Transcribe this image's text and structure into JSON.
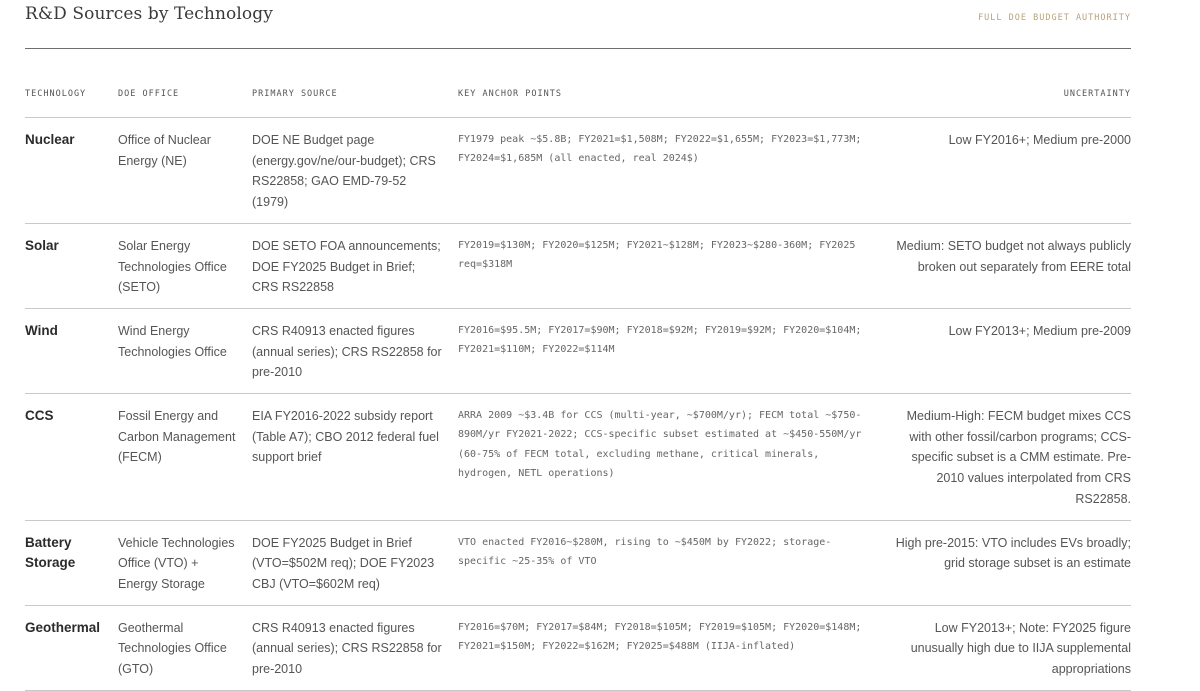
{
  "header": {
    "title": "R&D Sources by Technology",
    "subtitle": "FULL DOE BUDGET AUTHORITY"
  },
  "table": {
    "columns": [
      "TECHNOLOGY",
      "DOE OFFICE",
      "PRIMARY SOURCE",
      "KEY ANCHOR POINTS",
      "UNCERTAINTY"
    ],
    "rows": [
      {
        "technology": "Nuclear",
        "office": "Office of Nuclear Energy (NE)",
        "source": "DOE NE Budget page (energy.gov/ne/our-budget); CRS RS22858; GAO EMD-79-52 (1979)",
        "anchors": "FY1979 peak ~$5.8B; FY2021=$1,508M; FY2022=$1,655M; FY2023=$1,773M; FY2024=$1,685M (all enacted, real 2024$)",
        "uncertainty": "Low FY2016+; Medium pre-2000"
      },
      {
        "technology": "Solar",
        "office": "Solar Energy Technologies Office (SETO)",
        "source": "DOE SETO FOA announcements; DOE FY2025 Budget in Brief; CRS RS22858",
        "anchors": "FY2019=$130M; FY2020=$125M; FY2021~$128M; FY2023~$280-360M; FY2025 req=$318M",
        "uncertainty": "Medium: SETO budget not always publicly broken out separately from EERE total"
      },
      {
        "technology": "Wind",
        "office": "Wind Energy Technologies Office",
        "source": "CRS R40913 enacted figures (annual series); CRS RS22858 for pre-2010",
        "anchors": "FY2016=$95.5M; FY2017=$90M; FY2018=$92M; FY2019=$92M; FY2020=$104M; FY2021=$110M; FY2022=$114M",
        "uncertainty": "Low FY2013+; Medium pre-2009"
      },
      {
        "technology": "CCS",
        "office": "Fossil Energy and Carbon Management (FECM)",
        "source": "EIA FY2016-2022 subsidy report (Table A7); CBO 2012 federal fuel support brief",
        "anchors": "ARRA 2009 ~$3.4B for CCS (multi-year, ~$700M/yr); FECM total ~$750-890M/yr FY2021-2022; CCS-specific subset estimated at ~$450-550M/yr (60-75% of FECM total, excluding methane, critical minerals, hydrogen, NETL operations)",
        "uncertainty": "Medium-High: FECM budget mixes CCS with other fossil/carbon programs; CCS-specific subset is a CMM estimate. Pre-2010 values interpolated from CRS RS22858."
      },
      {
        "technology": "Battery Storage",
        "office": "Vehicle Technologies Office (VTO) + Energy Storage",
        "source": "DOE FY2025 Budget in Brief (VTO=$502M req); DOE FY2023 CBJ (VTO=$602M req)",
        "anchors": "VTO enacted FY2016~$280M, rising to ~$450M by FY2022; storage-specific ~25-35% of VTO",
        "uncertainty": "High pre-2015: VTO includes EVs broadly; grid storage subset is an estimate"
      },
      {
        "technology": "Geothermal",
        "office": "Geothermal Technologies Office (GTO)",
        "source": "CRS R40913 enacted figures (annual series); CRS RS22858 for pre-2010",
        "anchors": "FY2016=$70M; FY2017=$84M; FY2018=$105M; FY2019=$105M; FY2020=$148M; FY2021=$150M; FY2022=$162M; FY2025=$488M (IIJA-inflated)",
        "uncertainty": "Low FY2013+; Note: FY2025 figure unusually high due to IIJA supplemental appropriations"
      }
    ]
  }
}
